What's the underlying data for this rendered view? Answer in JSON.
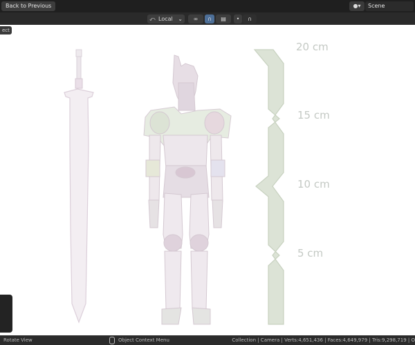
{
  "header": {
    "back_button": "Back to Previous",
    "scene_label": "Scene"
  },
  "toolbar": {
    "transform_orientation": "Local"
  },
  "mode_tab": "ect",
  "ruler": {
    "labels": [
      "20 cm",
      "15 cm",
      "10 cm",
      "5 cm"
    ]
  },
  "statusbar": {
    "left": "Rotate View",
    "middle": "Object Context Menu",
    "right": "Collection | Camera | Verts:4,651,436 | Faces:4,649,979 | Tris:9,298,719 | O"
  },
  "colors": {
    "ruler_fill": "#dce3d6",
    "ruler_stroke": "#c7d1bf",
    "ruler_text": "#c4c9c4",
    "ui_dark": "#2a2a2a",
    "ui_accent": "#4d6f98"
  }
}
